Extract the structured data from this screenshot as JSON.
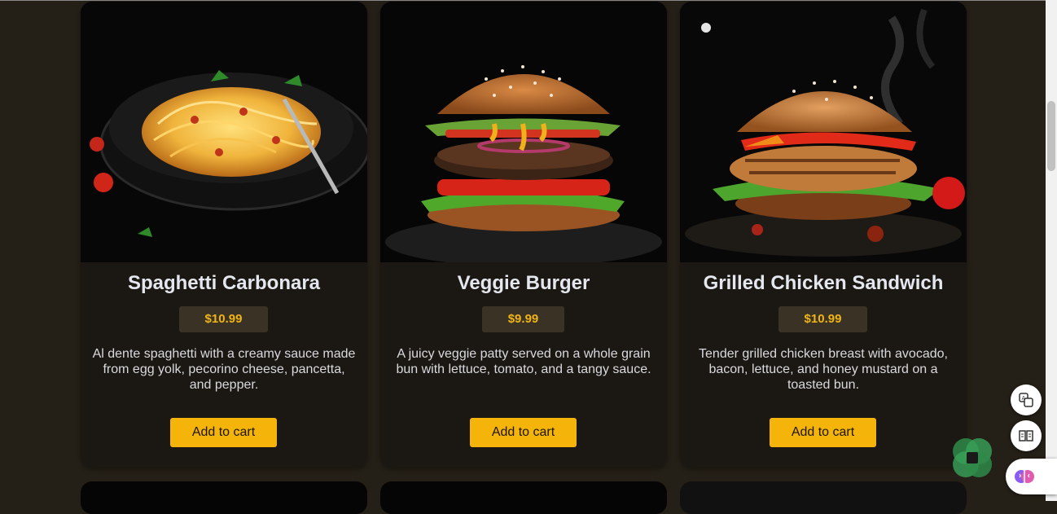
{
  "menu": {
    "items": [
      {
        "title": "Spaghetti Carbonara",
        "price": "$10.99",
        "description": "Al dente spaghetti with a creamy sauce made from egg yolk, pecorino cheese, pancetta, and pepper.",
        "button": "Add to cart",
        "image_icon": "pasta-photo"
      },
      {
        "title": "Veggie Burger",
        "price": "$9.99",
        "description": "A juicy veggie patty served on a whole grain bun with lettuce, tomato, and a tangy sauce.",
        "button": "Add to cart",
        "image_icon": "burger-photo"
      },
      {
        "title": "Grilled Chicken Sandwich",
        "price": "$10.99",
        "description": "Tender grilled chicken breast with avocado, bacon, lettuce, and honey mustard on a toasted bun.",
        "button": "Add to cart",
        "image_icon": "chicken-sandwich-photo"
      }
    ]
  },
  "colors": {
    "page_background": "#241f17",
    "card_background": "#1b1813",
    "accent": "#f5b40a",
    "price_text": "#f0b416"
  },
  "widgets": {
    "translate_icon": "translate-icon",
    "reader_icon": "book-icon",
    "assistant_icon": "brain-icon",
    "overlay_icon": "green-logo-icon"
  }
}
